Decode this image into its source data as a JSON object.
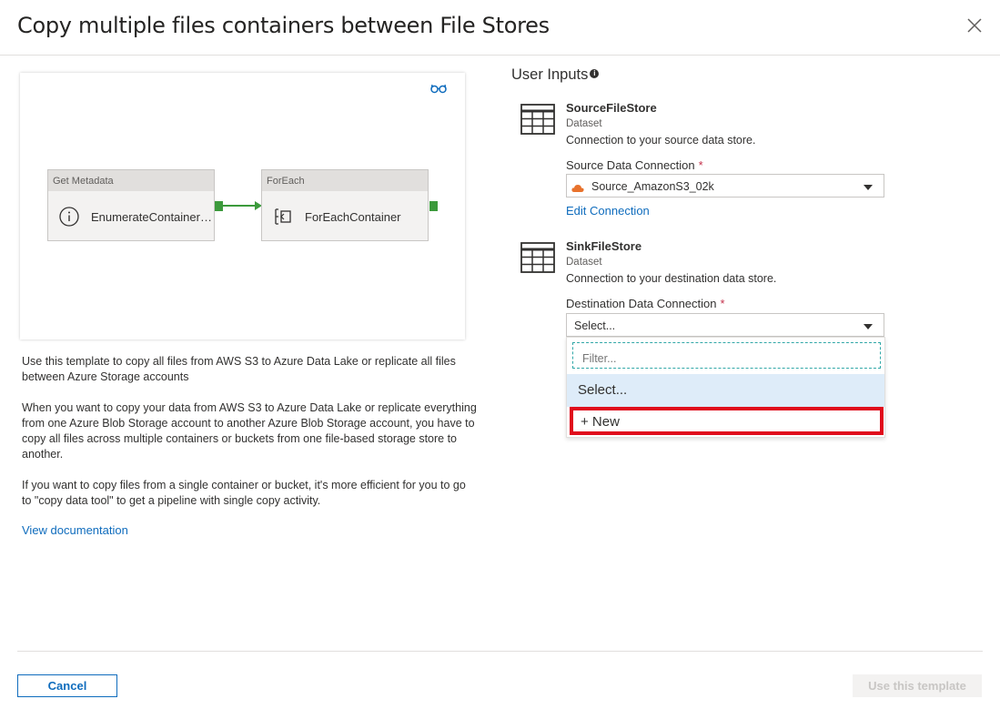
{
  "dialog": {
    "title": "Copy multiple files containers between File Stores",
    "close_icon": "close-icon"
  },
  "pipeline": {
    "activities": [
      {
        "type": "Get Metadata",
        "name": "EnumerateContainers...",
        "icon": "info-icon"
      },
      {
        "type": "ForEach",
        "name": "ForEachContainer",
        "icon": "foreach-icon"
      }
    ],
    "view_icon": "glasses-icon"
  },
  "description": {
    "p1": "Use this template to copy all files from AWS S3 to Azure Data Lake or replicate all files between Azure Storage accounts",
    "p2": "When you want to copy your data from AWS S3 to Azure Data Lake or replicate everything from one Azure Blob Storage account to another Azure Blob Storage account, you have to copy all files across multiple containers or buckets from one file-based storage store to another.",
    "p3": "If you want to copy files from a single container or bucket, it's more efficient for you to go to \"copy data tool\" to get a pipeline with single copy activity.",
    "doc_link": "View documentation"
  },
  "user_inputs": {
    "title": "User Inputs",
    "info_icon": "info-icon",
    "source": {
      "name": "SourceFileStore",
      "type": "Dataset",
      "description": "Connection to your source data store.",
      "field_label": "Source Data Connection",
      "required_mark": "*",
      "selected": "Source_AmazonS3_02k",
      "edit_link": "Edit Connection",
      "icon": "table-icon"
    },
    "sink": {
      "name": "SinkFileStore",
      "type": "Dataset",
      "description": "Connection to your destination data store.",
      "field_label": "Destination Data Connection",
      "required_mark": "*",
      "selected": "Select...",
      "filter_placeholder": "Filter...",
      "options": [
        "Select...",
        "+ New"
      ],
      "icon": "table-icon"
    }
  },
  "footer": {
    "cancel": "Cancel",
    "use_template": "Use this template"
  }
}
